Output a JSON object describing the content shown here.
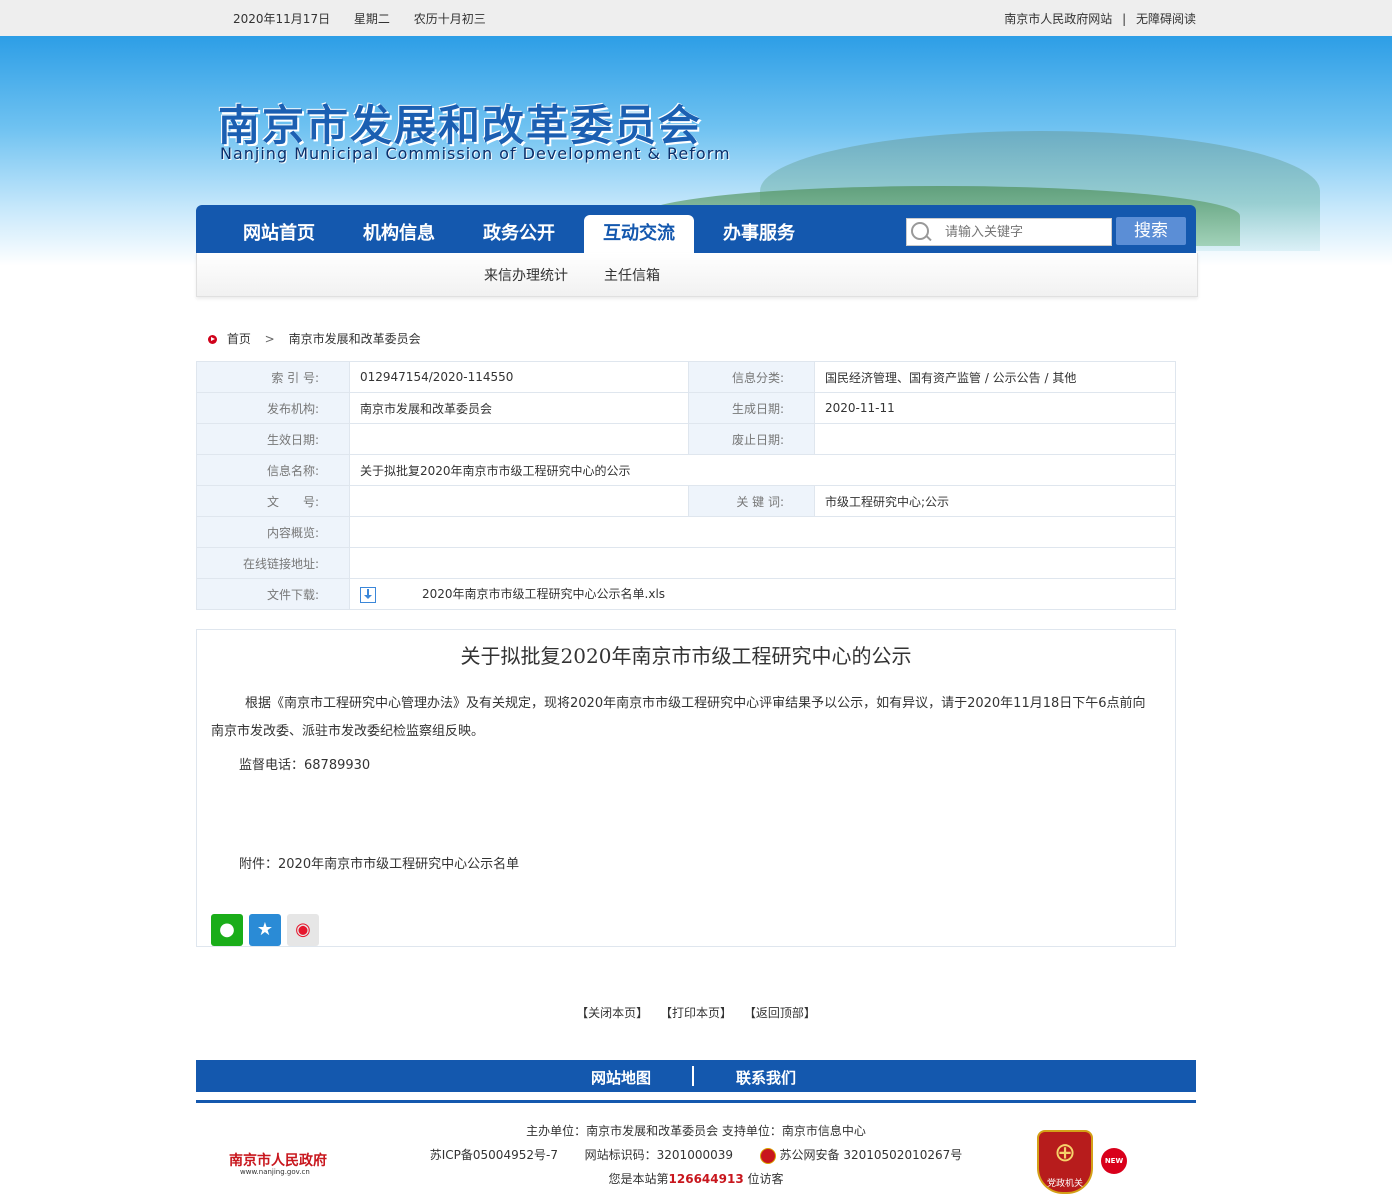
{
  "topbar": {
    "date": "2020年11月17日",
    "weekday": "星期二",
    "lunar": "农历十月初三",
    "link_gov": "南京市人民政府网站",
    "separator": "|",
    "link_accessibility": "无障碍阅读"
  },
  "banner": {
    "title_cn": "南京市发展和改革委员会",
    "title_en": "Nanjing Municipal Commission of Development & Reform"
  },
  "nav": {
    "items": [
      "网站首页",
      "机构信息",
      "政务公开",
      "互动交流",
      "办事服务"
    ],
    "active_index": 3,
    "search_placeholder": "请输入关键字",
    "search_button": "搜索"
  },
  "subnav": [
    "来信办理统计",
    "主任信箱"
  ],
  "breadcrumb": {
    "home": "首页",
    "arrow": ">",
    "current": "南京市发展和改革委员会"
  },
  "meta": {
    "index_label": "索 引 号:",
    "index_value": "012947154/2020-114550",
    "category_label": "信息分类:",
    "category_value": "国民经济管理、国有资产监管 / 公示公告 / 其他",
    "publisher_label": "发布机构:",
    "publisher_value": "南京市发展和改革委员会",
    "gen_date_label": "生成日期:",
    "gen_date_value": "2020-11-11",
    "eff_date_label": "生效日期:",
    "eff_date_value": "",
    "abolish_label": "废止日期:",
    "abolish_value": "",
    "name_label": "信息名称:",
    "name_value": "关于拟批复2020年南京市市级工程研究中心的公示",
    "doc_no_label": "文　　号:",
    "doc_no_value": "",
    "keywords_label": "关 键 词:",
    "keywords_value": "市级工程研究中心;公示",
    "summary_label": "内容概览:",
    "summary_value": "",
    "online_link_label": "在线链接地址:",
    "online_link_value": "",
    "download_label": "文件下载:",
    "download_file": "2020年南京市市级工程研究中心公示名单.xls"
  },
  "article": {
    "title": "关于拟批复2020年南京市市级工程研究中心的公示",
    "para1": "根据《南京市工程研究中心管理办法》及有关规定，现将2020年南京市市级工程研究中心评审结果予以公示，如有异议，请于2020年11月18日下午6点前向南京市发改委、派驻市发改委纪检监察组反映。",
    "para2": "监督电话：68789930",
    "para3": "附件：2020年南京市市级工程研究中心公示名单"
  },
  "share": {
    "wechat_icon": "wechat-icon",
    "qzone_icon": "qzone-icon",
    "weibo_icon": "weibo-icon"
  },
  "page_links": {
    "close": "【关闭本页】",
    "print": "【打印本页】",
    "top": "【返回顶部】"
  },
  "footer_nav": {
    "sitemap": "网站地图",
    "contact": "联系我们"
  },
  "footer": {
    "gov_logo": "南京市人民政府",
    "gov_url": "www.nanjing.gov.cn",
    "host": "主办单位：南京市发展和改革委员会  支持单位：南京市信息中心",
    "icp": "苏ICP备05004952号-7",
    "site_id": "网站标识码：3201000039",
    "police": "苏公网安备 32010502010267号",
    "visitor_prefix": "您是本站第",
    "visitor_count": "126644913",
    "visitor_suffix": " 位访客",
    "party_badge": "党政机关",
    "new_badge": "NEW"
  }
}
